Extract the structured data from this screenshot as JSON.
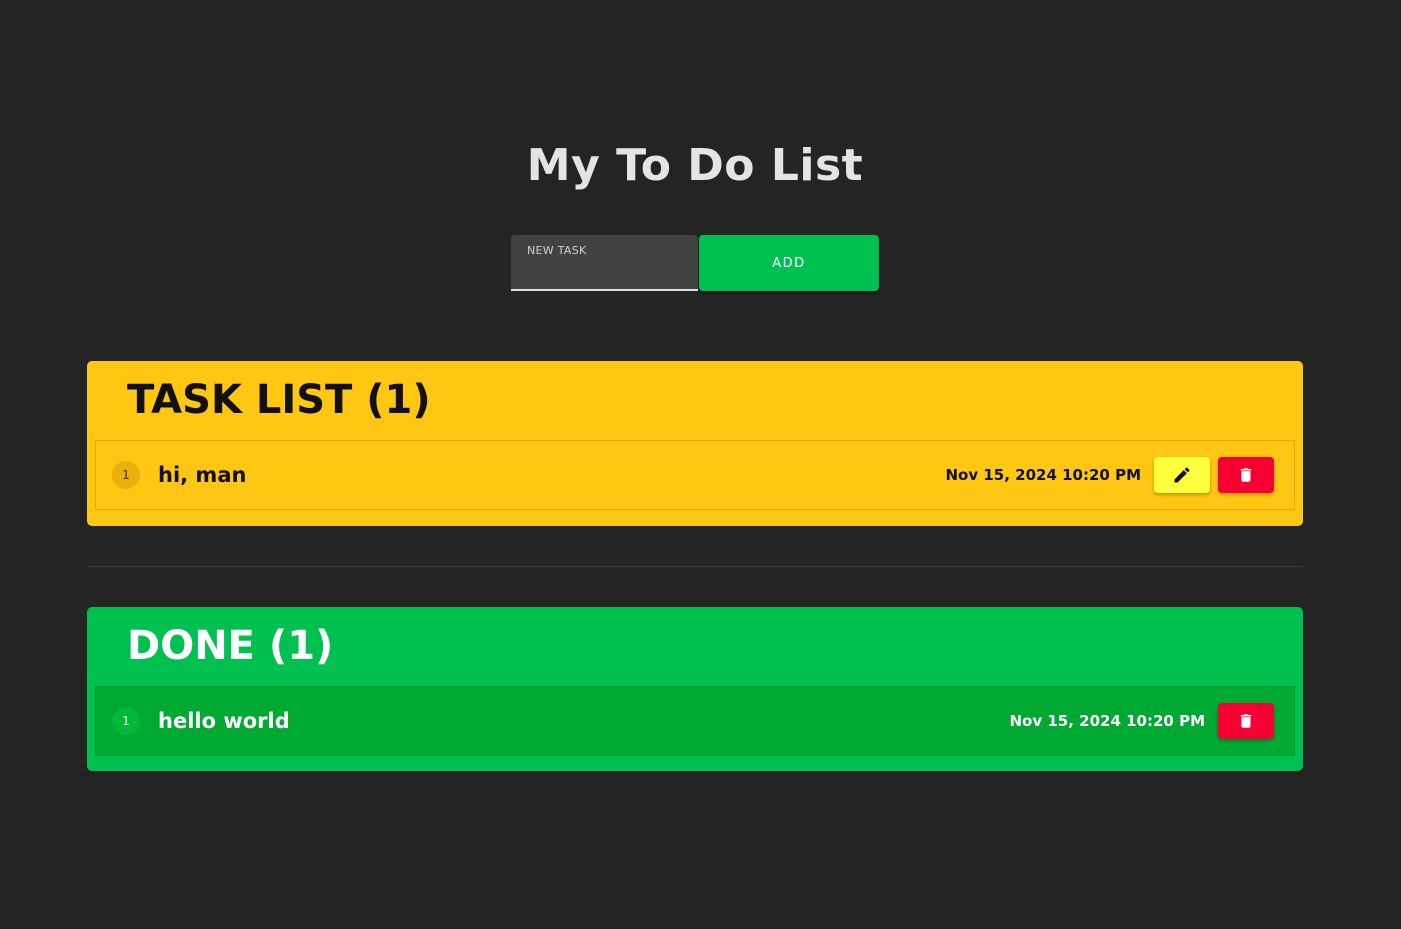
{
  "app": {
    "title": "My To Do List"
  },
  "new_task": {
    "label": "NEW TASK",
    "value": "",
    "add_label": "ADD"
  },
  "task_list": {
    "title": "TASK LIST (1)",
    "items": [
      {
        "index": "1",
        "text": "hi, man",
        "date": "Nov 15, 2024 10:20 PM",
        "actions": [
          "pencil-icon",
          "trash-icon"
        ]
      }
    ]
  },
  "done_list": {
    "title": "DONE (1)",
    "items": [
      {
        "index": "1",
        "text": "hello world",
        "date": "Nov 15, 2024 10:20 PM",
        "actions": [
          "trash-icon"
        ]
      }
    ]
  },
  "colors": {
    "background": "#242424",
    "task_card": "#ffc613",
    "done_card": "#00c04f",
    "add_button": "#00c04f",
    "edit_button": "#ffff3d",
    "delete_button": "#f50033"
  }
}
